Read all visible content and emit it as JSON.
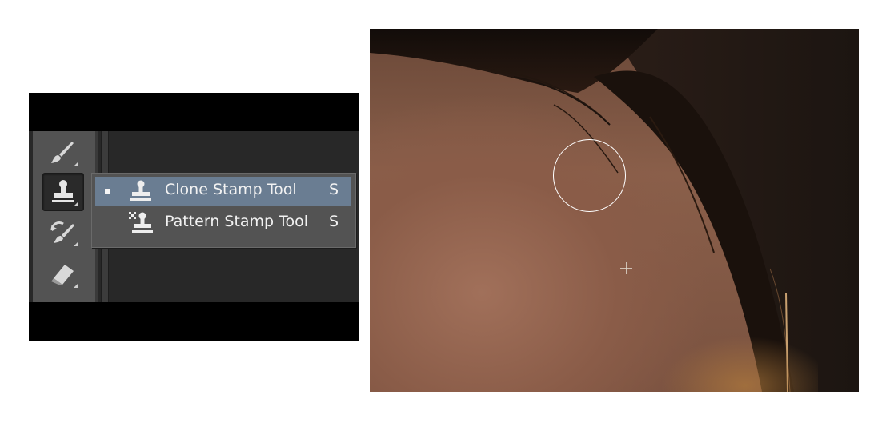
{
  "toolbar": {
    "tools": [
      {
        "icon": "brush-icon",
        "active": false
      },
      {
        "icon": "clone-stamp-icon",
        "active": true
      },
      {
        "icon": "history-brush-icon",
        "active": false
      },
      {
        "icon": "eraser-icon",
        "active": false
      }
    ]
  },
  "flyout": {
    "items": [
      {
        "label": "Clone Stamp Tool",
        "shortcut": "S",
        "icon": "clone-stamp-icon",
        "selected": true
      },
      {
        "label": "Pattern Stamp Tool",
        "shortcut": "S",
        "icon": "pattern-stamp-icon",
        "selected": false
      }
    ]
  },
  "canvas": {
    "content": "photo",
    "cursor": "clone-stamp-brush-circle",
    "source_marker": "crosshair"
  },
  "colors": {
    "panel_bg": "#282828",
    "toolbar_bg": "#535353",
    "selection": "#6a7d92",
    "text": "#f2f2f2"
  }
}
